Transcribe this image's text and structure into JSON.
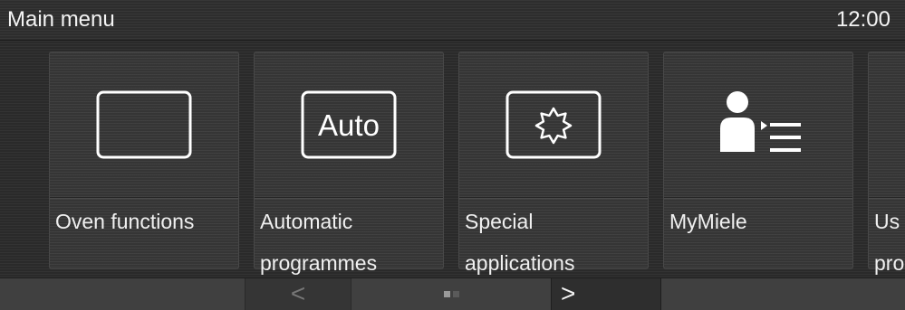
{
  "header": {
    "title": "Main menu",
    "clock": "12:00"
  },
  "tiles": [
    {
      "label": "Oven functions",
      "icon": "oven-functions-icon"
    },
    {
      "label": "Automatic\nprogrammes",
      "icon": "auto-icon",
      "icon_text": "Auto"
    },
    {
      "label": "Special\napplications",
      "icon": "special-applications-icon"
    },
    {
      "label": "MyMiele",
      "icon": "mymiele-icon"
    },
    {
      "label": "Us\npro",
      "icon": ""
    }
  ],
  "footer": {
    "prev": "<",
    "next": ">",
    "page_count": 2,
    "current_page": 1
  },
  "colors": {
    "background": "#2a2a2a",
    "tile": "#383838",
    "text": "#f2f2f2",
    "icon": "#ffffff"
  }
}
